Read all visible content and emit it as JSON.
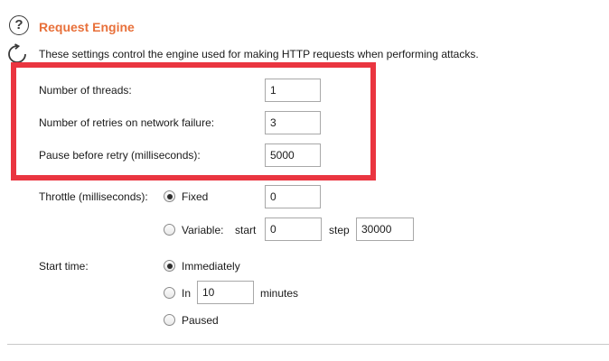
{
  "section": {
    "title": "Request Engine",
    "description": "These settings control the engine used for making HTTP requests when performing attacks.",
    "help_icon": "?"
  },
  "icons": {
    "help": "help-circle-icon",
    "refresh": "refresh-icon"
  },
  "settings": {
    "threads": {
      "label": "Number of threads:",
      "value": "1"
    },
    "retries": {
      "label": "Number of retries on network failure:",
      "value": "3"
    },
    "pause": {
      "label": "Pause before retry (milliseconds):",
      "value": "5000"
    }
  },
  "throttle": {
    "label": "Throttle (milliseconds):",
    "fixed": {
      "label": "Fixed",
      "value": "0",
      "selected": true
    },
    "variable": {
      "label": "Variable:",
      "start_label": "start",
      "start_value": "0",
      "step_label": "step",
      "step_value": "30000",
      "selected": false
    }
  },
  "start_time": {
    "label": "Start time:",
    "immediately": {
      "label": "Immediately",
      "selected": true
    },
    "in": {
      "label": "In",
      "value": "10",
      "unit": "minutes",
      "selected": false
    },
    "paused": {
      "label": "Paused",
      "selected": false
    }
  },
  "colors": {
    "title": "#e8703a",
    "highlight": "#ea3540"
  }
}
